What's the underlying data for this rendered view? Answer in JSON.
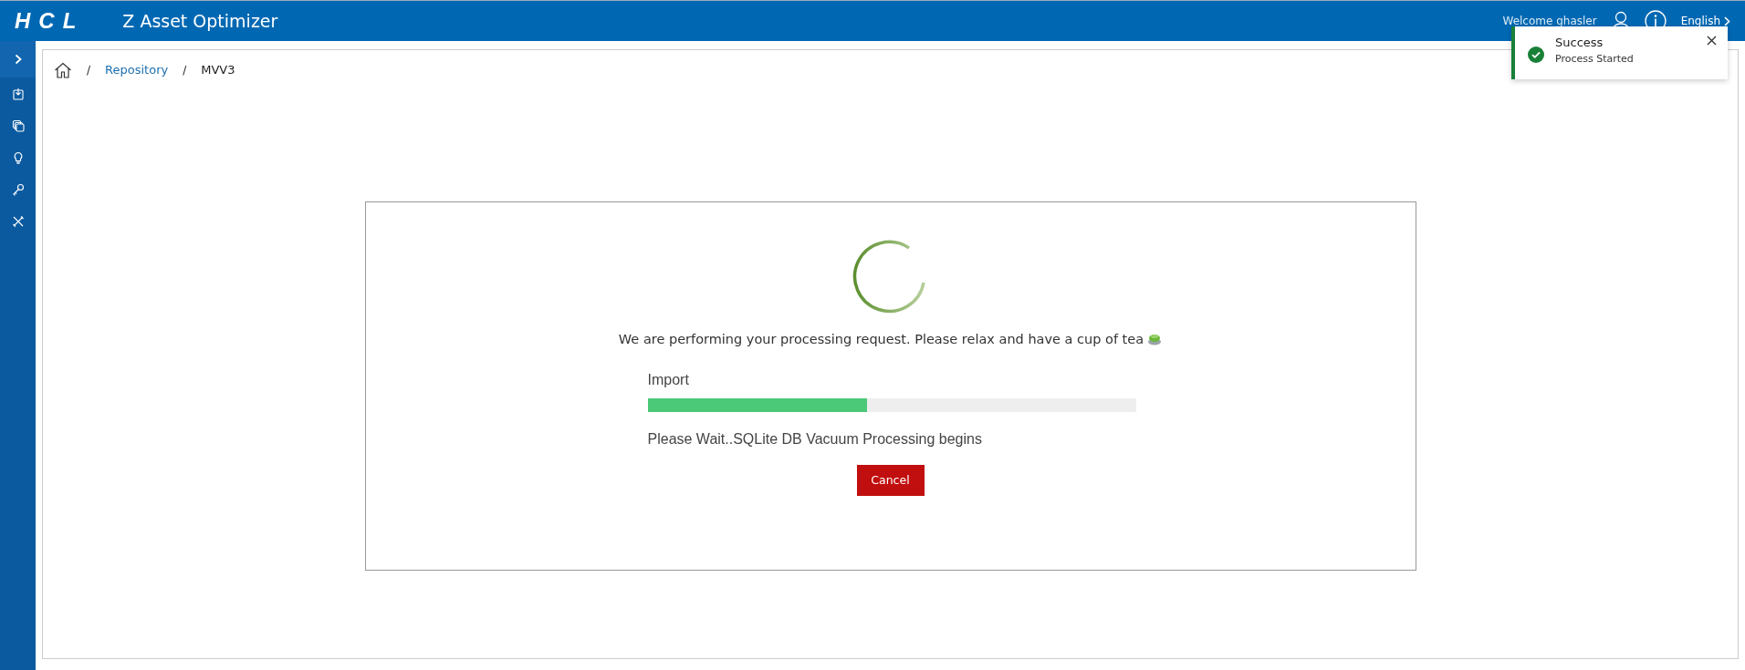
{
  "header": {
    "logo": "HCL",
    "title": "Z Asset Optimizer",
    "welcome": "Welcome ghasler",
    "language": "English"
  },
  "sidebar": {
    "items": [
      {
        "kind": "upload"
      },
      {
        "kind": "stack"
      },
      {
        "kind": "bulb"
      },
      {
        "kind": "key"
      },
      {
        "kind": "tools"
      }
    ]
  },
  "breadcrumb": [
    {
      "separator": "/",
      "label": "Repository",
      "kind": "link"
    },
    {
      "separator": "/",
      "label": "MVV3",
      "kind": "current"
    }
  ],
  "processing": {
    "message": "We are performing your processing request. Please relax and have a cup of tea",
    "task": "Import",
    "level": 0.45,
    "status": "Please Wait..SQLite DB Vacuum Processing begins",
    "cancel": "Cancel"
  },
  "toast": {
    "kind": "success",
    "title": "Success",
    "message": "Process Started"
  }
}
